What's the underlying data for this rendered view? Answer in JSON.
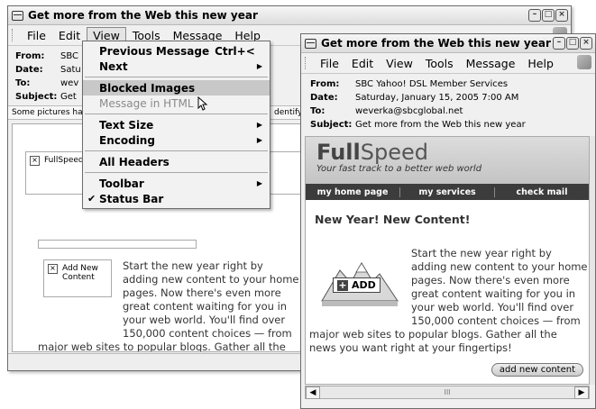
{
  "window_title": "Get more from the Web this new year",
  "menus": [
    "File",
    "Edit",
    "View",
    "Tools",
    "Message",
    "Help"
  ],
  "header_labels": {
    "from": "From:",
    "date": "Date:",
    "to": "To:",
    "subject": "Subject:"
  },
  "w1": {
    "from": "SBC",
    "date": "Satu",
    "to": "wev",
    "subject": "Get",
    "infobar_left": "Some pictures hav",
    "infobar_right": "dentifying",
    "img1": "FullSpeed",
    "img2": "Add New Content",
    "body_lines": [
      "Start the new year right by",
      "adding new content to your home",
      "pages. Now there's even more",
      "great content waiting for you in",
      "your web world. You'll find over",
      "150,000 content choices — from"
    ],
    "body_wrap": "major web sites to popular blogs. Gather all the"
  },
  "view_menu": {
    "previous_message": "Previous Message",
    "previous_shortcut": "Ctrl+<",
    "next": "Next",
    "blocked_images": "Blocked Images",
    "message_in_html": "Message in HTML",
    "text_size": "Text Size",
    "encoding": "Encoding",
    "all_headers": "All Headers",
    "toolbar": "Toolbar",
    "status_bar": "Status Bar"
  },
  "w2": {
    "from": "SBC Yahoo! DSL Member Services",
    "date": "Saturday, January 15, 2005 7:00 AM",
    "to": "weverka@sbcglobal.net",
    "subject": "Get more from the Web this new year",
    "logo_bold": "Full",
    "logo_light": "Speed",
    "tagline": "Your fast track to a better web world",
    "nav": [
      "my home page",
      "my services",
      "check mail"
    ],
    "heading": "New Year! New Content!",
    "add_label": "ADD",
    "body_lines": [
      "Start the new year right by",
      "adding new content to your home",
      "pages. Now there's even more",
      "great content waiting for you in",
      "your web world. You'll find over",
      "150,000 content choices — from"
    ],
    "body_tail": [
      "major web sites to popular blogs. Gather all the",
      "news you want right at your fingertips!"
    ],
    "button": "add new content"
  }
}
